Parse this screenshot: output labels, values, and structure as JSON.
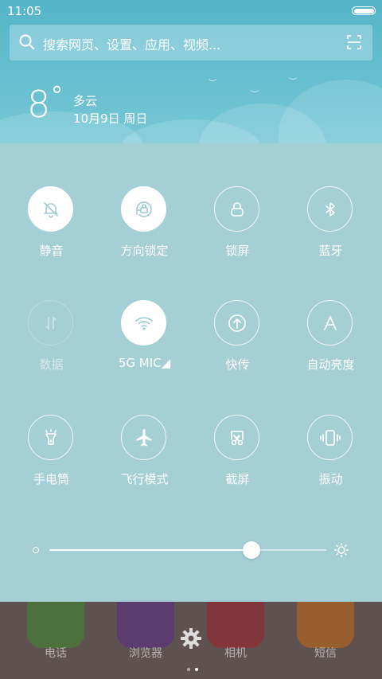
{
  "status_bar": {
    "time": "11:05",
    "battery_level": 1.0
  },
  "search": {
    "placeholder": "搜索网页、设置、应用、视频..."
  },
  "weather": {
    "temperature": "8",
    "degree_symbol": "°",
    "condition": "多云",
    "date": "10月9日 周日"
  },
  "quick_settings": {
    "tiles": [
      {
        "label": "静音",
        "icon": "bell-off-icon",
        "state": "on"
      },
      {
        "label": "方向锁定",
        "icon": "rotation-lock-icon",
        "state": "on"
      },
      {
        "label": "锁屏",
        "icon": "lock-icon",
        "state": "off"
      },
      {
        "label": "蓝牙",
        "icon": "bluetooth-icon",
        "state": "off"
      },
      {
        "label": "数据",
        "icon": "data-arrows-icon",
        "state": "disabled"
      },
      {
        "label": "5G      MIC◢",
        "icon": "wifi-icon",
        "state": "on"
      },
      {
        "label": "快传",
        "icon": "upload-icon",
        "state": "off"
      },
      {
        "label": "自动亮度",
        "icon": "auto-brightness-icon",
        "state": "off"
      },
      {
        "label": "手电筒",
        "icon": "flashlight-icon",
        "state": "off"
      },
      {
        "label": "飞行模式",
        "icon": "airplane-icon",
        "state": "off"
      },
      {
        "label": "截屏",
        "icon": "screenshot-icon",
        "state": "off"
      },
      {
        "label": "振动",
        "icon": "vibrate-icon",
        "state": "off"
      }
    ],
    "brightness_level": 0.73
  },
  "dock": {
    "apps": [
      {
        "label": "电话",
        "icon": "phone-icon",
        "color": "#3f8a2e"
      },
      {
        "label": "浏览器",
        "icon": "browser-icon",
        "color": "#5b2a86"
      },
      {
        "label": "相机",
        "icon": "camera-icon",
        "color": "#a01f2a"
      },
      {
        "label": "短信",
        "icon": "message-icon",
        "color": "#c86a12"
      }
    ],
    "page_count": 2,
    "active_page": 2
  },
  "colors": {
    "header": "#5fbbcd",
    "panel": "#a4cfd5",
    "dock": "#5e5250"
  }
}
